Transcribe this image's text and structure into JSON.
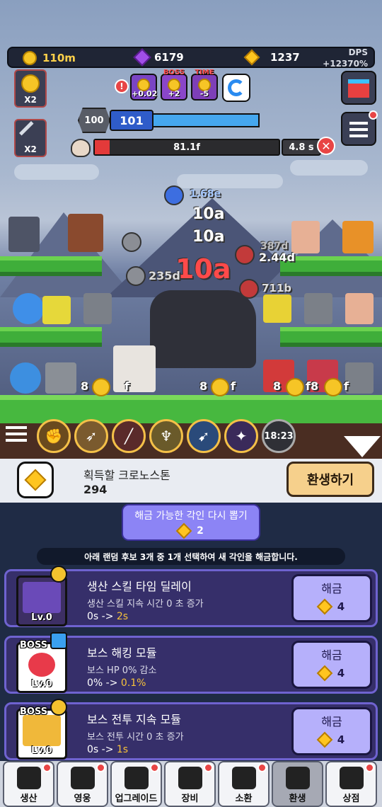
{
  "currency": {
    "gold": "110m",
    "gems": "6179",
    "chronostone": "1237",
    "dps_label": "DPS",
    "dps_value": "+12370%"
  },
  "buttons": {
    "gold_multiplier": "X2",
    "attack_multiplier": "X2",
    "alert_icon": "!"
  },
  "boosts": [
    {
      "tag": "",
      "label": "+0.02",
      "color": "#7a44c4"
    },
    {
      "tag": "BOSS",
      "label": "+2",
      "color": "#8a46c9"
    },
    {
      "tag": "TIME",
      "label": "-5",
      "color": "#7d3fb7"
    }
  ],
  "stage": {
    "previous": "100",
    "current": "101",
    "progress": 0.02
  },
  "boss": {
    "hp_text": "81.1f",
    "hp_fraction": 0.08,
    "timer": "4.8 s"
  },
  "floating_damage": [
    {
      "text": "1.68e",
      "size": 14,
      "color": "#a7c9ff"
    },
    {
      "text": "10a",
      "size": 22,
      "color": "#ffffff"
    },
    {
      "text": "10a",
      "size": 22,
      "color": "#ffffff"
    },
    {
      "text": "10a",
      "size": 38,
      "color": "#ff4a4a"
    },
    {
      "text": "2.44d",
      "size": 16,
      "color": "#ffffff"
    },
    {
      "text": "387d",
      "size": 14,
      "color": "#bfbfbf"
    },
    {
      "text": "235d",
      "size": 16,
      "color": "#dddddd"
    },
    {
      "text": "711b",
      "size": 15,
      "color": "#dddddd"
    },
    {
      "text": "8",
      "size": 16,
      "color": "#ffffff"
    },
    {
      "text": "f",
      "size": 16,
      "color": "#ffffff"
    },
    {
      "text": "8",
      "size": 16,
      "color": "#ffffff"
    },
    {
      "text": "f",
      "size": 16,
      "color": "#ffffff"
    },
    {
      "text": "8",
      "size": 16,
      "color": "#ffffff"
    },
    {
      "text": "f8",
      "size": 16,
      "color": "#ffffff"
    },
    {
      "text": "f",
      "size": 16,
      "color": "#ffffff"
    }
  ],
  "skills": [
    "fist-icon",
    "horn-icon",
    "slash-icon",
    "warrior-icon",
    "arrow-icon",
    "crystal-icon"
  ],
  "skill_cooldown": "18:23",
  "chronostone_panel": {
    "title": "획득할 크로노스톤",
    "value": "294",
    "rebirth_button": "환생하기"
  },
  "reroll": {
    "title": "해금 가능한 각인 다시 뽑기",
    "cost": "2"
  },
  "info_text": "아래 랜덤 후보 3개 중 1개 선택하여 새 각인을 해금합니다.",
  "cards": [
    {
      "title": "생산 스킬 타임 딜레이",
      "desc": "생산 스킬 지속 시간 0 초 증가",
      "from": "0s -> ",
      "to": "2s",
      "level": "Lv.0",
      "boss": "",
      "icon_color": "#3d2f64",
      "button": "해금",
      "cost": "4"
    },
    {
      "title": "보스 해킹 모듈",
      "desc": "보스 HP 0% 감소",
      "from": "0% -> ",
      "to": "0.1%",
      "level": "Lv.0",
      "boss": "BOSS",
      "icon_color": "#ffffff",
      "button": "해금",
      "cost": "4"
    },
    {
      "title": "보스 전투 지속 모듈",
      "desc": "보스 전투 시간 0 초 증가",
      "from": "0s -> ",
      "to": "1s",
      "level": "Lv.0",
      "boss": "BOSS",
      "icon_color": "#ffffff",
      "button": "해금",
      "cost": "4"
    }
  ],
  "nav": [
    {
      "label": "생산",
      "icon": "anvil-icon",
      "dot": true,
      "active": false
    },
    {
      "label": "영웅",
      "icon": "heroes-icon",
      "dot": true,
      "active": false
    },
    {
      "label": "업그레이드",
      "icon": "battery-icon",
      "dot": true,
      "active": false
    },
    {
      "label": "장비",
      "icon": "briefcase-icon",
      "dot": true,
      "active": false
    },
    {
      "label": "소환",
      "icon": "summon-card-icon",
      "dot": true,
      "active": false
    },
    {
      "label": "환생",
      "icon": "hourglass-icon",
      "dot": false,
      "active": true
    },
    {
      "label": "상점",
      "icon": "cart-icon",
      "dot": true,
      "active": false
    }
  ]
}
